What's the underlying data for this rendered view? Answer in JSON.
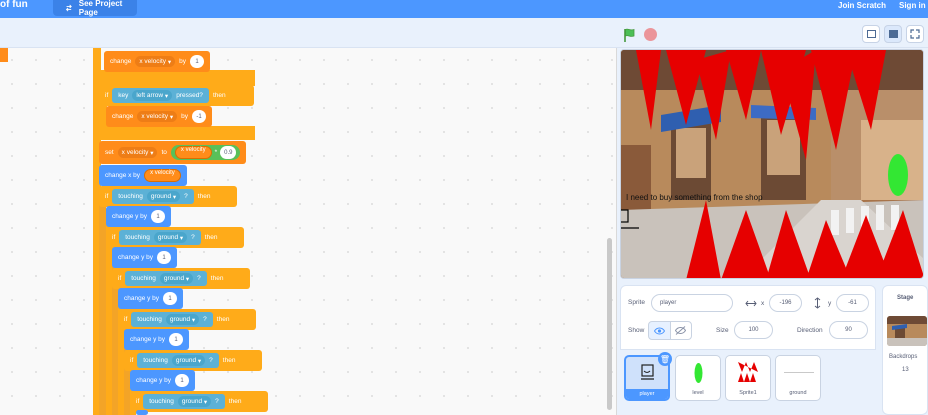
{
  "topbar": {
    "title": "of fun",
    "see_project": "See Project Page",
    "join": "Join Scratch",
    "signin": "Sign in"
  },
  "code": {
    "change_x1": {
      "label": "change",
      "var": "x velocity",
      "by": "by",
      "val": "1"
    },
    "if_left": {
      "if": "if",
      "key": "key",
      "key_opt": "left arrow",
      "pressed": "pressed?",
      "then": "then"
    },
    "change_x2": {
      "label": "change",
      "var": "x velocity",
      "by": "by",
      "val": "-1"
    },
    "set_x": {
      "label": "set",
      "var": "x velocity",
      "to": "to",
      "rep": "x velocity",
      "op": "*",
      "val": "0.9"
    },
    "change_xby": {
      "label": "change x by",
      "rep": "x velocity"
    },
    "touching": {
      "if": "if",
      "label": "touching",
      "target": "ground",
      "q": "?",
      "then": "then"
    },
    "change_yby": {
      "label": "change y by",
      "val": "1"
    }
  },
  "stage": {
    "say": "I need to buy something from the shop"
  },
  "sprite_info": {
    "sprite_label": "Sprite",
    "sprite_name": "player",
    "x_label": "x",
    "x_value": "-196",
    "y_label": "y",
    "y_value": "-61",
    "show_label": "Show",
    "size_label": "Size",
    "size_value": "100",
    "direction_label": "Direction",
    "direction_value": "90"
  },
  "sprites": [
    "player",
    "level",
    "Sprite1",
    "ground"
  ],
  "stage_panel": {
    "title": "Stage",
    "backdrops_label": "Backdrops",
    "backdrops_count": "13"
  }
}
